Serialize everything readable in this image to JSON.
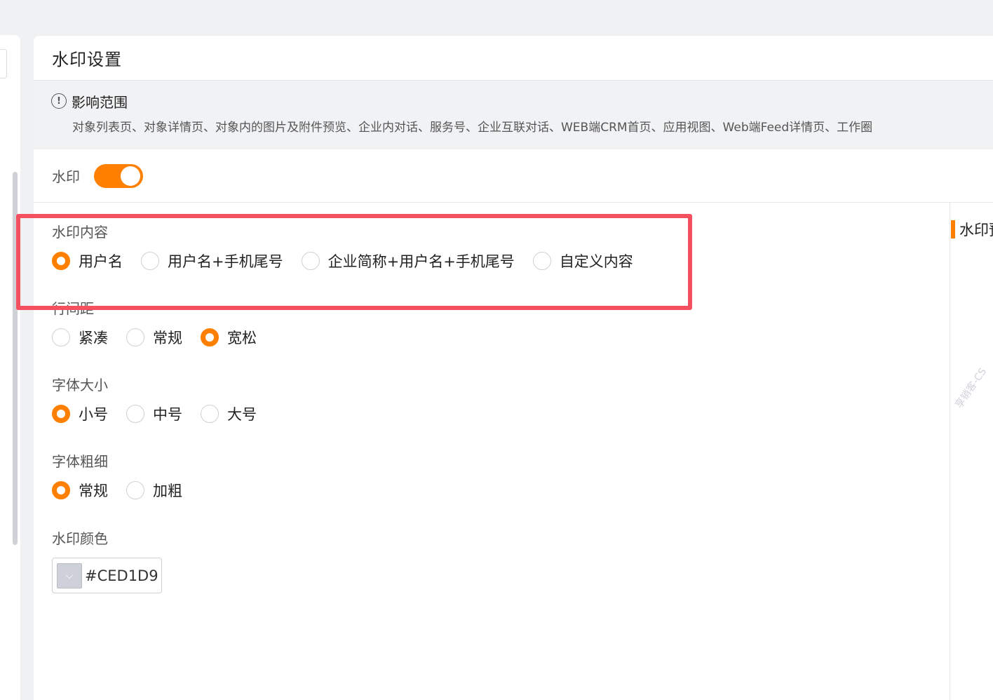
{
  "page": {
    "title": "水印设置"
  },
  "scope": {
    "title": "影响范围",
    "description": "对象列表页、对象详情页、对象内的图片及附件预览、企业内对话、服务号、企业互联对话、WEB端CRM首页、应用视图、Web端Feed详情页、工作圈"
  },
  "watermark_toggle": {
    "label": "水印",
    "on": true
  },
  "content": {
    "label": "水印内容",
    "options": [
      "用户名",
      "用户名+手机尾号",
      "企业简称+用户名+手机尾号",
      "自定义内容"
    ],
    "selected": "用户名"
  },
  "line_spacing": {
    "label": "行间距",
    "options": [
      "紧凑",
      "常规",
      "宽松"
    ],
    "selected": "宽松"
  },
  "font_size": {
    "label": "字体大小",
    "options": [
      "小号",
      "中号",
      "大号"
    ],
    "selected": "小号"
  },
  "font_weight": {
    "label": "字体粗细",
    "options": [
      "常规",
      "加粗"
    ],
    "selected": "常规"
  },
  "color": {
    "label": "水印颜色",
    "value": "#CED1D9",
    "swatch": "#ced1d9"
  },
  "preview": {
    "title": "水印预览",
    "watermark_sample": "享销客-CS"
  },
  "colors": {
    "accent": "#ff8000",
    "highlight": "#f55060"
  }
}
